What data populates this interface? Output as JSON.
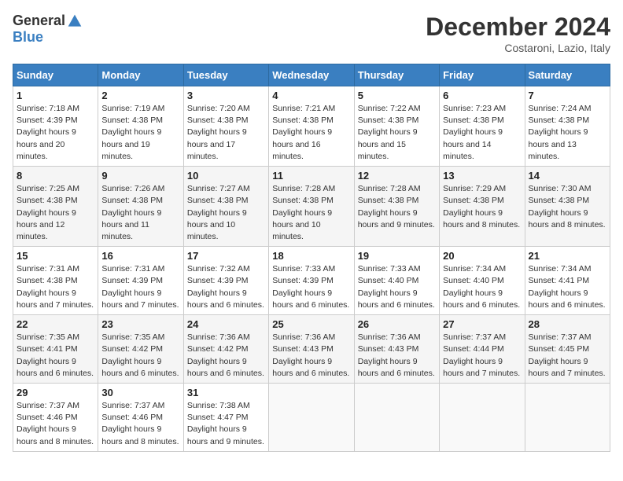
{
  "header": {
    "logo_general": "General",
    "logo_blue": "Blue",
    "month_title": "December 2024",
    "location": "Costaroni, Lazio, Italy"
  },
  "weekdays": [
    "Sunday",
    "Monday",
    "Tuesday",
    "Wednesday",
    "Thursday",
    "Friday",
    "Saturday"
  ],
  "weeks": [
    [
      {
        "day": "1",
        "sunrise": "7:18 AM",
        "sunset": "4:39 PM",
        "daylight": "9 hours and 20 minutes."
      },
      {
        "day": "2",
        "sunrise": "7:19 AM",
        "sunset": "4:38 PM",
        "daylight": "9 hours and 19 minutes."
      },
      {
        "day": "3",
        "sunrise": "7:20 AM",
        "sunset": "4:38 PM",
        "daylight": "9 hours and 17 minutes."
      },
      {
        "day": "4",
        "sunrise": "7:21 AM",
        "sunset": "4:38 PM",
        "daylight": "9 hours and 16 minutes."
      },
      {
        "day": "5",
        "sunrise": "7:22 AM",
        "sunset": "4:38 PM",
        "daylight": "9 hours and 15 minutes."
      },
      {
        "day": "6",
        "sunrise": "7:23 AM",
        "sunset": "4:38 PM",
        "daylight": "9 hours and 14 minutes."
      },
      {
        "day": "7",
        "sunrise": "7:24 AM",
        "sunset": "4:38 PM",
        "daylight": "9 hours and 13 minutes."
      }
    ],
    [
      {
        "day": "8",
        "sunrise": "7:25 AM",
        "sunset": "4:38 PM",
        "daylight": "9 hours and 12 minutes."
      },
      {
        "day": "9",
        "sunrise": "7:26 AM",
        "sunset": "4:38 PM",
        "daylight": "9 hours and 11 minutes."
      },
      {
        "day": "10",
        "sunrise": "7:27 AM",
        "sunset": "4:38 PM",
        "daylight": "9 hours and 10 minutes."
      },
      {
        "day": "11",
        "sunrise": "7:28 AM",
        "sunset": "4:38 PM",
        "daylight": "9 hours and 10 minutes."
      },
      {
        "day": "12",
        "sunrise": "7:28 AM",
        "sunset": "4:38 PM",
        "daylight": "9 hours and 9 minutes."
      },
      {
        "day": "13",
        "sunrise": "7:29 AM",
        "sunset": "4:38 PM",
        "daylight": "9 hours and 8 minutes."
      },
      {
        "day": "14",
        "sunrise": "7:30 AM",
        "sunset": "4:38 PM",
        "daylight": "9 hours and 8 minutes."
      }
    ],
    [
      {
        "day": "15",
        "sunrise": "7:31 AM",
        "sunset": "4:38 PM",
        "daylight": "9 hours and 7 minutes."
      },
      {
        "day": "16",
        "sunrise": "7:31 AM",
        "sunset": "4:39 PM",
        "daylight": "9 hours and 7 minutes."
      },
      {
        "day": "17",
        "sunrise": "7:32 AM",
        "sunset": "4:39 PM",
        "daylight": "9 hours and 6 minutes."
      },
      {
        "day": "18",
        "sunrise": "7:33 AM",
        "sunset": "4:39 PM",
        "daylight": "9 hours and 6 minutes."
      },
      {
        "day": "19",
        "sunrise": "7:33 AM",
        "sunset": "4:40 PM",
        "daylight": "9 hours and 6 minutes."
      },
      {
        "day": "20",
        "sunrise": "7:34 AM",
        "sunset": "4:40 PM",
        "daylight": "9 hours and 6 minutes."
      },
      {
        "day": "21",
        "sunrise": "7:34 AM",
        "sunset": "4:41 PM",
        "daylight": "9 hours and 6 minutes."
      }
    ],
    [
      {
        "day": "22",
        "sunrise": "7:35 AM",
        "sunset": "4:41 PM",
        "daylight": "9 hours and 6 minutes."
      },
      {
        "day": "23",
        "sunrise": "7:35 AM",
        "sunset": "4:42 PM",
        "daylight": "9 hours and 6 minutes."
      },
      {
        "day": "24",
        "sunrise": "7:36 AM",
        "sunset": "4:42 PM",
        "daylight": "9 hours and 6 minutes."
      },
      {
        "day": "25",
        "sunrise": "7:36 AM",
        "sunset": "4:43 PM",
        "daylight": "9 hours and 6 minutes."
      },
      {
        "day": "26",
        "sunrise": "7:36 AM",
        "sunset": "4:43 PM",
        "daylight": "9 hours and 6 minutes."
      },
      {
        "day": "27",
        "sunrise": "7:37 AM",
        "sunset": "4:44 PM",
        "daylight": "9 hours and 7 minutes."
      },
      {
        "day": "28",
        "sunrise": "7:37 AM",
        "sunset": "4:45 PM",
        "daylight": "9 hours and 7 minutes."
      }
    ],
    [
      {
        "day": "29",
        "sunrise": "7:37 AM",
        "sunset": "4:46 PM",
        "daylight": "9 hours and 8 minutes."
      },
      {
        "day": "30",
        "sunrise": "7:37 AM",
        "sunset": "4:46 PM",
        "daylight": "9 hours and 8 minutes."
      },
      {
        "day": "31",
        "sunrise": "7:38 AM",
        "sunset": "4:47 PM",
        "daylight": "9 hours and 9 minutes."
      },
      null,
      null,
      null,
      null
    ]
  ]
}
